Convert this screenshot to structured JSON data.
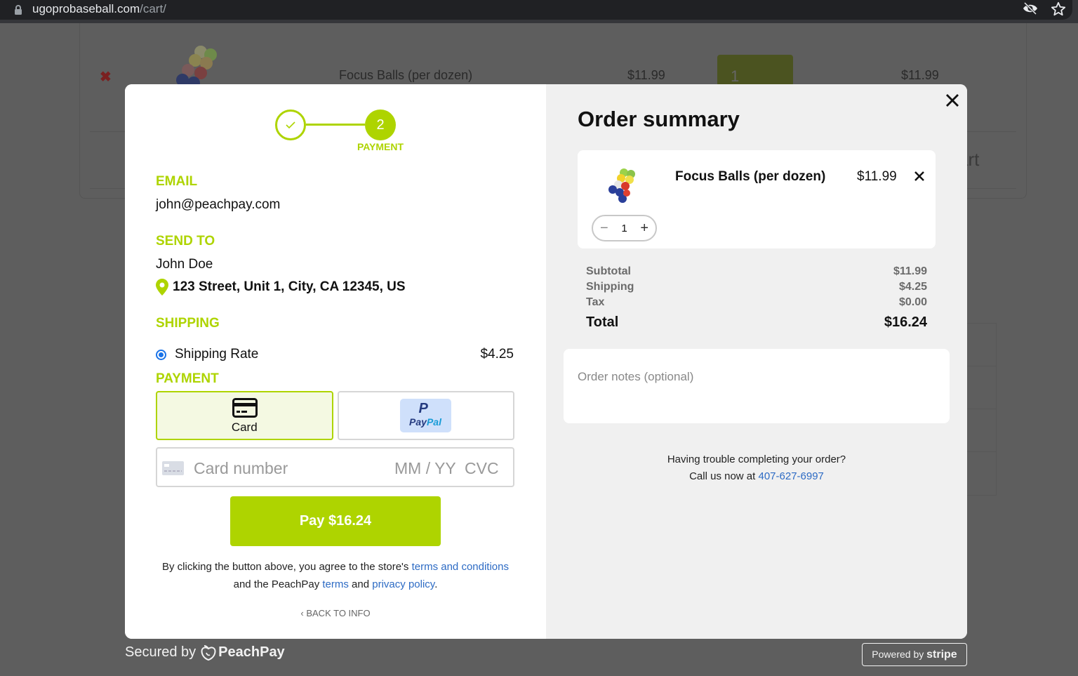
{
  "browser": {
    "url_domain": "ugoprobaseball.com",
    "url_path": "/cart/",
    "icons": [
      "lock-icon",
      "eye-off-icon",
      "star-icon"
    ]
  },
  "background_cart": {
    "product_name": "Focus Balls (per dozen)",
    "price": "$11.99",
    "quantity": "1",
    "subtotal": "$11.99",
    "cart_button_partial": "art"
  },
  "stepper": {
    "step1_state": "complete",
    "step2_number": "2",
    "step2_label": "PAYMENT"
  },
  "checkout": {
    "email_label": "EMAIL",
    "email": "john@peachpay.com",
    "send_to_label": "SEND TO",
    "name": "John Doe",
    "address": "123 Street, Unit 1, City, CA 12345, US",
    "shipping_label": "SHIPPING",
    "shipping_option": "Shipping Rate",
    "shipping_price": "$4.25",
    "shipping_selected": true,
    "payment_label": "PAYMENT",
    "payment_methods": [
      {
        "id": "card",
        "label": "Card",
        "selected": true
      },
      {
        "id": "paypal",
        "label_part1": "Pay",
        "label_part2": "Pal",
        "selected": false
      }
    ],
    "card_number_placeholder": "Card number",
    "card_exp_placeholder": "MM / YY",
    "card_cvc_placeholder": "CVC",
    "pay_button": "Pay $16.24",
    "legal": {
      "text1": "By clicking the button above, you agree to the store's ",
      "link1": "terms and conditions",
      "text2": " and the PeachPay ",
      "link2": "terms",
      "text3": " and ",
      "link3": "privacy policy",
      "text4": "."
    },
    "back_link": "BACK TO INFO"
  },
  "order_summary": {
    "title": "Order summary",
    "items": [
      {
        "name": "Focus Balls (per dozen)",
        "price": "$11.99",
        "quantity": "1"
      }
    ],
    "subtotal_label": "Subtotal",
    "subtotal": "$11.99",
    "shipping_label": "Shipping",
    "shipping": "$4.25",
    "tax_label": "Tax",
    "tax": "$0.00",
    "total_label": "Total",
    "total": "$16.24",
    "notes_placeholder": "Order notes (optional)",
    "help_text": "Having trouble completing your order?",
    "call_text": "Call us now at ",
    "phone": "407-627-6997"
  },
  "footer": {
    "secured_by": "Secured by",
    "peachpay_brand": "PeachPay",
    "powered_by": "Powered by",
    "stripe_brand": "stripe"
  },
  "colors": {
    "accent": "#aed400",
    "link": "#2d6bc4",
    "overlay": "#5e5e5e"
  }
}
